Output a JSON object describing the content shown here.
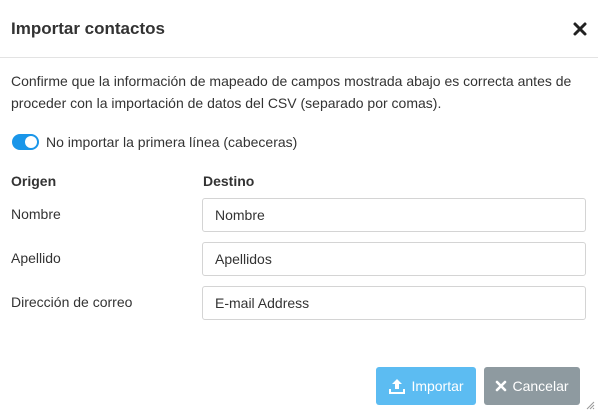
{
  "dialog": {
    "title": "Importar contactos",
    "close_icon": "close-icon"
  },
  "description": "Confirme que la información de mapeado de campos mostrada abajo es correcta antes de proceder con la importación de datos del CSV (separado por comas).",
  "skip_header_toggle": {
    "label": "No importar la primera línea (cabeceras)",
    "checked": true,
    "color": "#1a96e9"
  },
  "mapping": {
    "source_header": "Origen",
    "target_header": "Destino",
    "rows": [
      {
        "source": "Nombre",
        "target": "Nombre"
      },
      {
        "source": "Apellido",
        "target": "Apellidos"
      },
      {
        "source": "Dirección de correo",
        "target": "E-mail Address"
      }
    ]
  },
  "buttons": {
    "import_label": "Importar",
    "import_icon": "upload-icon",
    "import_color": "#5cbcf2",
    "cancel_label": "Cancelar",
    "cancel_icon": "x-icon",
    "cancel_color": "#8e9aa0"
  }
}
